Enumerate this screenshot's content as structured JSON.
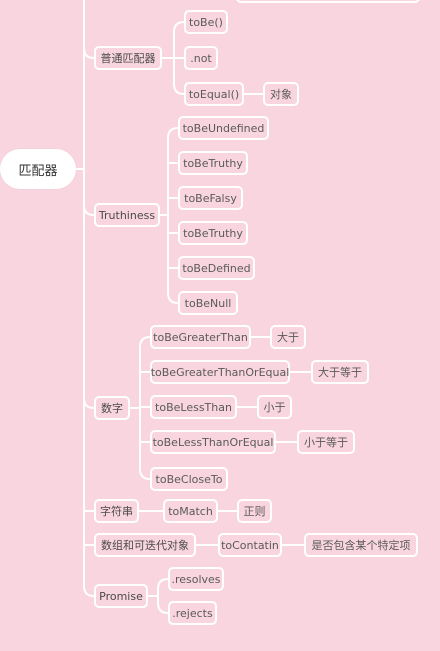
{
  "root": {
    "label": "匹配器"
  },
  "groups": {
    "common": {
      "label": "普通匹配器",
      "items": {
        "tobe": "toBe()",
        "not": ".not",
        "toequal": "toEqual()",
        "toequal_note": "对象"
      }
    },
    "truthiness": {
      "label": "Truthiness",
      "items": [
        "toBeUndefined",
        "toBeTruthy",
        "toBeFalsy",
        "toBeTruthy",
        "toBeDefined",
        "toBeNull"
      ]
    },
    "numbers": {
      "label": "数字",
      "items": [
        "toBeGreaterThan",
        "toBeGreaterThanOrEqual",
        "toBeLessThan",
        "toBeLessThanOrEqual",
        "toBeCloseTo"
      ],
      "notes": [
        "大于",
        "大于等于",
        "小于",
        "小于等于"
      ]
    },
    "strings": {
      "label": "字符串",
      "item": "toMatch",
      "note": "正则"
    },
    "arrays": {
      "label": "数组和可迭代对象",
      "item": "toContatin",
      "note": "是否包含某个特定项"
    },
    "promise": {
      "label": "Promise",
      "items": [
        ".resolves",
        ".rejects"
      ]
    }
  },
  "colors": {
    "background": "#f9d6df",
    "line": "#ffffff",
    "text": "#4a4a4a"
  }
}
